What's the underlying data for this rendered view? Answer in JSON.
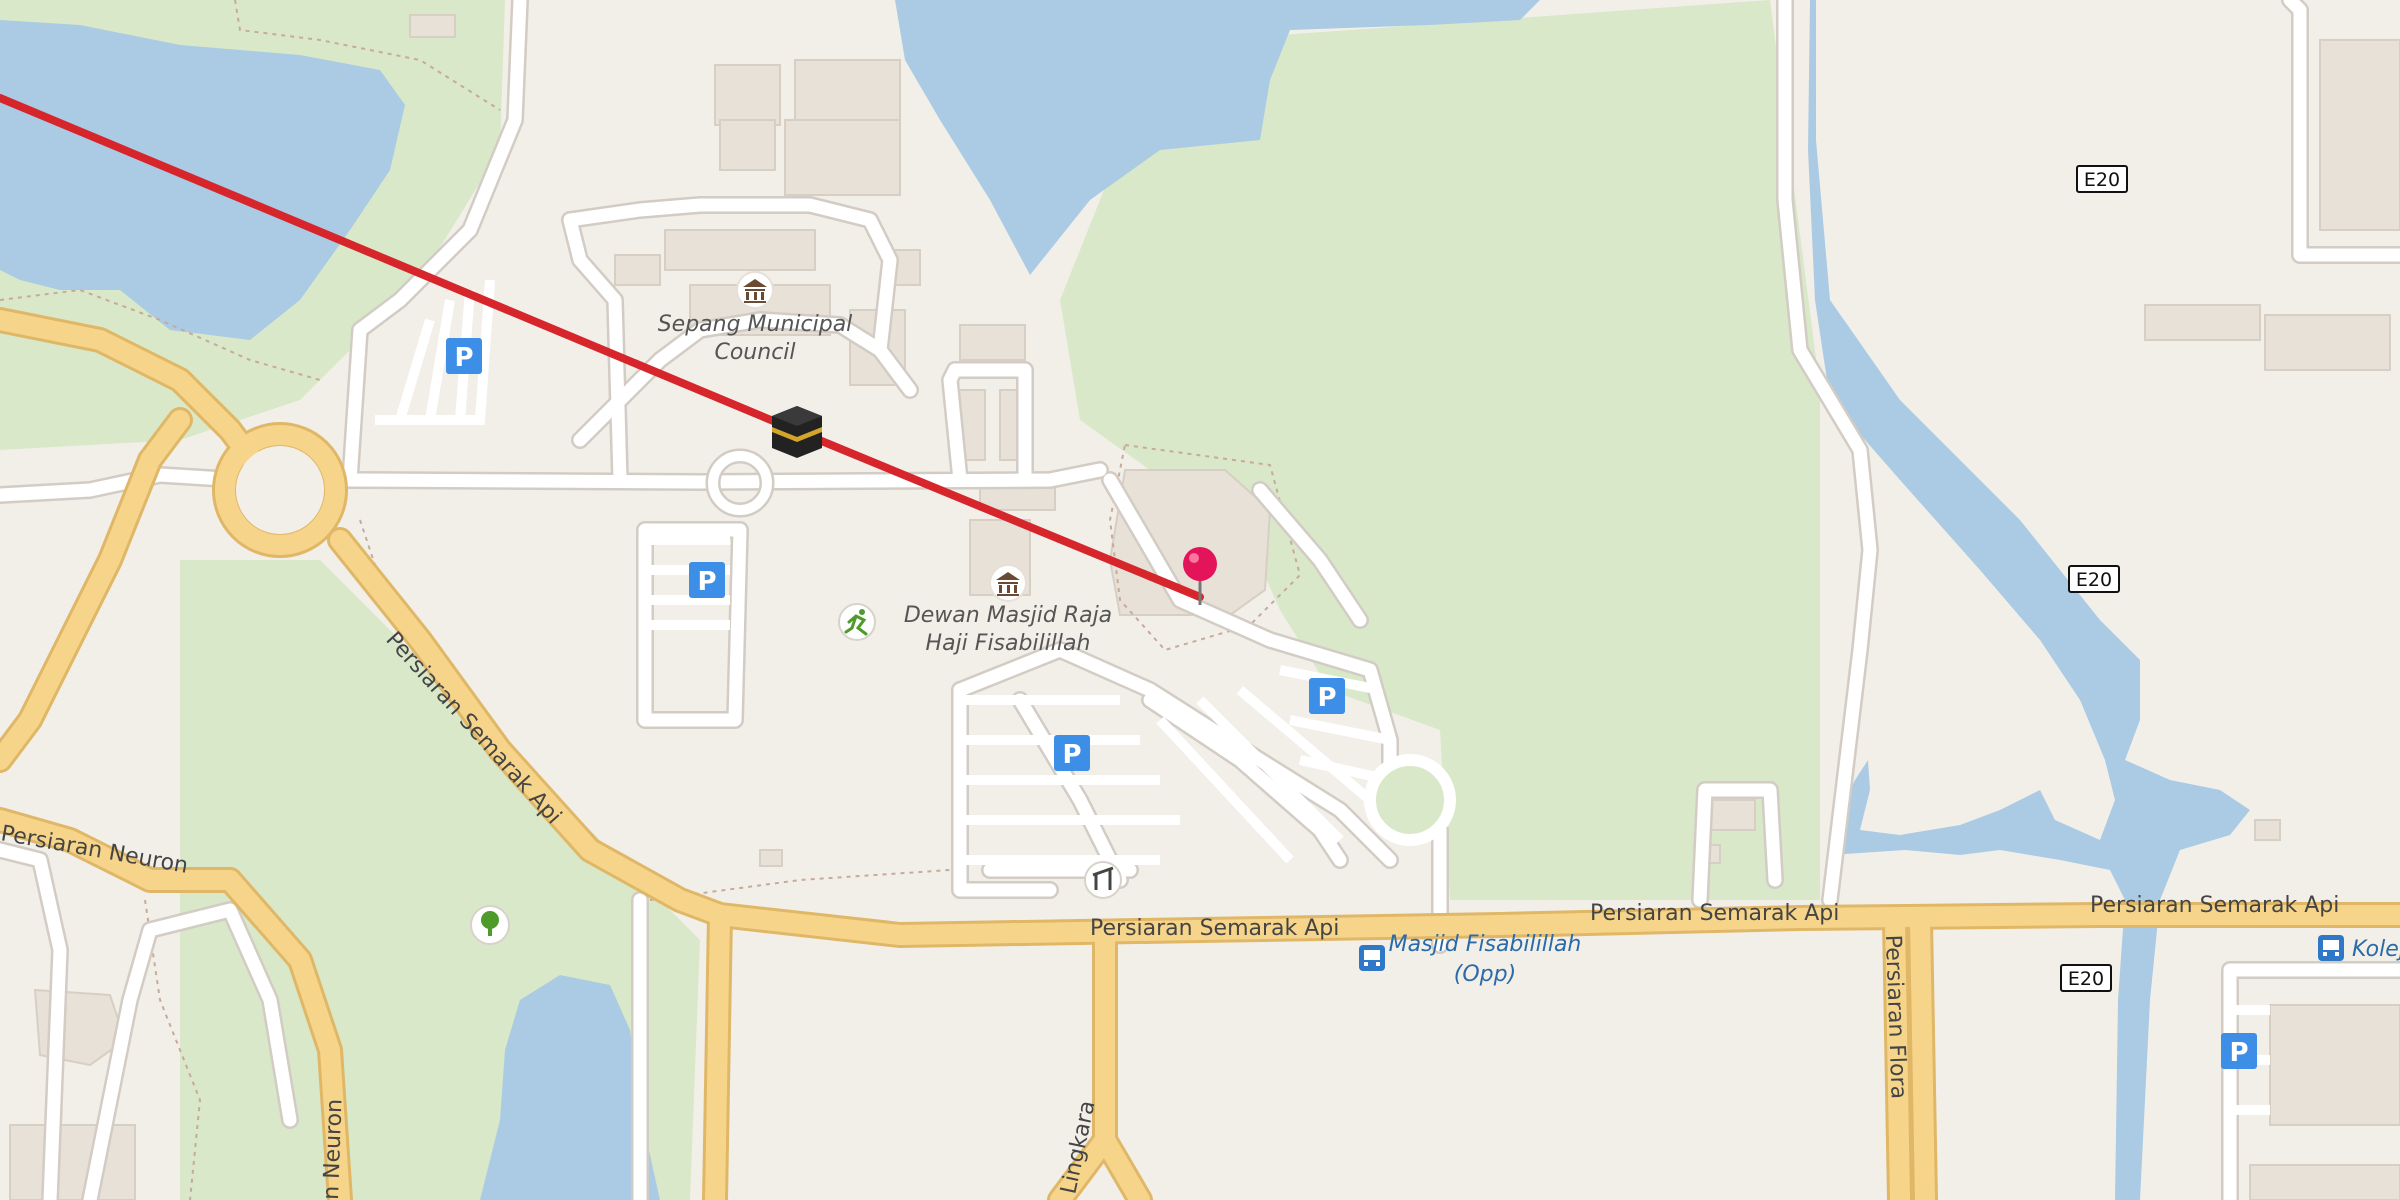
{
  "places": {
    "municipal_council_line1": "Sepang Municipal",
    "municipal_council_line2": "Council",
    "dewan_line1": "Dewan Masjid Raja",
    "dewan_line2": "Haji Fisabilillah",
    "bus_stop_line1": "Masjid Fisabilillah",
    "bus_stop_line2": "(Opp)",
    "bus_stop_right": "Kolej"
  },
  "roads": {
    "semarak_api_diag": "Persiaran Semarak Api",
    "semarak_api_1": "Persiaran Semarak Api",
    "semarak_api_2": "Persiaran Semarak Api",
    "semarak_api_3": "Persiaran Semarak Api",
    "neuron_1": "Persiaran Neuron",
    "neuron_2": "n Neuron",
    "flora": "Persiaran Flora",
    "lingkaran": "Lingkara"
  },
  "shields": {
    "e20_1": "E20",
    "e20_2": "E20",
    "e20_3": "E20"
  },
  "parking_label": "P",
  "icons": {
    "selected_pin": "map-pin-icon",
    "kaaba": "kaaba-icon",
    "townhall": "townhall-icon",
    "parking": "parking-icon",
    "bus": "bus-stop-icon",
    "tree": "tree-icon",
    "fitness": "fitness-icon",
    "shelter": "shelter-icon"
  },
  "colors": {
    "land": "#f2efe9",
    "water": "#aacbe3",
    "park": "#d9e8c8",
    "major_road": "#f6d58b",
    "minor_road": "#ffffff",
    "route_line": "#d6262b",
    "parking_blue": "#3d8ee6",
    "pin": "#e4145a"
  }
}
